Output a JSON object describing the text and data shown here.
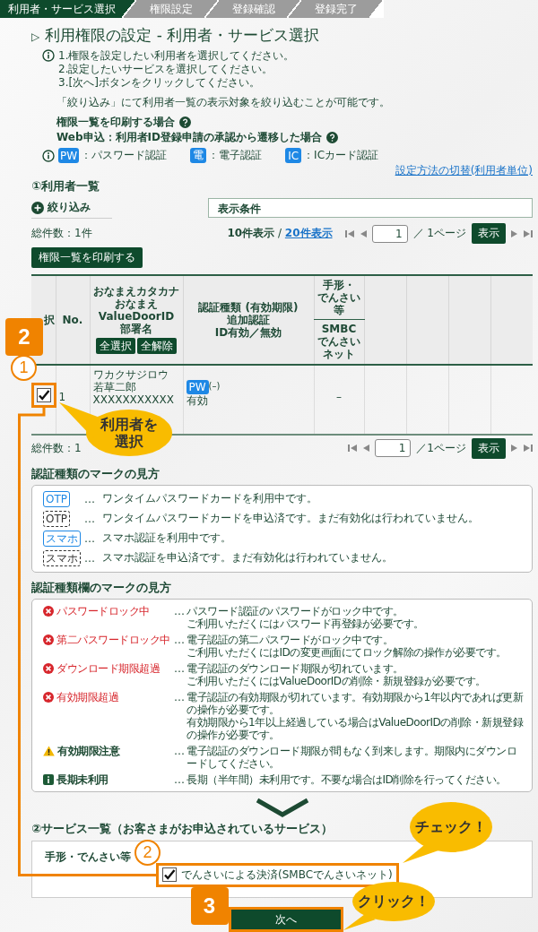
{
  "steps": [
    {
      "label": "利用者・サービス選択",
      "selected": true
    },
    {
      "label": "権限設定",
      "selected": false
    },
    {
      "label": "登録確認",
      "selected": false
    },
    {
      "label": "登録完了",
      "selected": false
    }
  ],
  "title_marker": "▷",
  "title": "利用権限の設定 - 利用者・サービス選択",
  "instructions": [
    "1.権限を設定したい利用者を選択してください。",
    "2.設定したいサービスを選択してください。",
    "3.[次へ]ボタンをクリックしてください。"
  ],
  "filter_note": "「絞り込み」にて利用者一覧の表示対象を絞り込むことが可能です。",
  "help_links": [
    "権限一覧を印刷する場合",
    "Web申込：利用者ID登録申請の承認から遷移した場合"
  ],
  "auth_legend": [
    {
      "badge": "PW",
      "label": "：パスワード認証"
    },
    {
      "badge": "電",
      "label": "：電子認証"
    },
    {
      "badge": "IC",
      "label": "：ICカード認証"
    }
  ],
  "switch_link": "設定方法の切替(利用者単位)",
  "user_list": {
    "heading": "①利用者一覧",
    "filter_button": "絞り込み",
    "conditions_label": "表示条件",
    "total": "総件数：1件",
    "page_size": {
      "current": "10件表示",
      "separator": "/",
      "other": "20件表示"
    },
    "pager_top": {
      "page": "1",
      "total": "／ 1ページ",
      "go": "表示"
    },
    "print_button": "権限一覧を印刷する",
    "columns": [
      {
        "lines": [
          "択"
        ]
      },
      {
        "lines": [
          "No."
        ]
      },
      {
        "lines": [
          "おなまえカタカナ",
          "おなまえ",
          "ValueDoorID",
          "部署名"
        ],
        "buttons": [
          "全選択",
          "全解除"
        ]
      },
      {
        "lines": [
          "認証種類 (有効期限)",
          "追加認証",
          "ID有効／無効"
        ]
      },
      {
        "lines": [
          "手形・",
          "でんさい",
          "等"
        ],
        "sub_lines": [
          "SMBC",
          "でんさい",
          "ネット"
        ]
      }
    ],
    "rows": [
      {
        "selected": true,
        "no": "1",
        "kana": "ワカクサジロウ",
        "name": "若草二郎",
        "id": "XXXXXXXXXXX",
        "auth_badge": "PW",
        "auth_note": "(–)",
        "status": "有効",
        "service": "–"
      }
    ],
    "total_bottom": "総件数：1",
    "pager_bottom": {
      "page": "1",
      "total": "／1ページ",
      "go": "表示"
    }
  },
  "mark_legend": {
    "heading": "認証種類のマークの見方",
    "items": [
      {
        "icon": "OTP",
        "kind": "active",
        "dots": "…",
        "text": "ワンタイムパスワードカードを利用中です。"
      },
      {
        "icon": "OTP",
        "kind": "pending",
        "dots": "…",
        "text": "ワンタイムパスワードカードを申込済です。まだ有効化は行われていません。"
      },
      {
        "icon": "スマホ",
        "kind": "active",
        "dots": "…",
        "text": "スマホ認証を利用中です。"
      },
      {
        "icon": "スマホ",
        "kind": "pending",
        "dots": "…",
        "text": "スマホ認証を申込済です。まだ有効化は行われていません。"
      }
    ]
  },
  "status_legend": {
    "heading": "認証種類欄のマークの見方",
    "items": [
      {
        "kind": "error",
        "label": "パスワードロック中",
        "dots": "…",
        "lines": [
          "パスワード認証のパスワードがロック中です。",
          "ご利用いただくにはパスワード再登録が必要です。"
        ]
      },
      {
        "kind": "error",
        "label": "第二パスワードロック中",
        "dots": "…",
        "lines": [
          "電子認証の第二パスワードがロック中です。",
          "ご利用いただくにはIDの変更画面にてロック解除の操作が必要です。"
        ]
      },
      {
        "kind": "error",
        "label": "ダウンロード期限超過",
        "dots": "…",
        "lines": [
          "電子認証のダウンロード期限が切れています。",
          "ご利用いただくにはValueDoorIDの削除・新規登録が必要です。"
        ]
      },
      {
        "kind": "error",
        "label": "有効期限超過",
        "dots": "…",
        "lines": [
          "電子認証の有効期限が切れています。有効期限から1年以内であれば更新の操作が必要です。",
          "有効期限から1年以上経過している場合はValueDoorIDの削除・新規登録の操作が必要です。"
        ]
      },
      {
        "kind": "warning",
        "label": "有効期限注意",
        "dots": "…",
        "lines": [
          "電子認証のダウンロード期限が間もなく到来します。期限内にダウンロードしてください。"
        ]
      },
      {
        "kind": "info",
        "label": "長期未利用",
        "dots": "…",
        "lines": [
          "長期（半年間）未利用です。不要な場合はID削除を行ってください。"
        ]
      }
    ]
  },
  "services": {
    "heading": "②サービス一覧（お客さまがお申込されているサービス）",
    "groups": [
      {
        "label": "手形・でんさい等",
        "options": [
          {
            "label": "でんさいによる決済(SMBCでんさいネット)",
            "checked": true
          }
        ]
      }
    ]
  },
  "next_button": "次へ",
  "annotations": {
    "step_badges": [
      "2",
      "3"
    ],
    "circle_marks": [
      "1",
      "2"
    ],
    "callouts": [
      [
        "利用者を",
        "選択"
      ],
      [
        "チェック！"
      ],
      [
        "クリック！"
      ]
    ]
  }
}
